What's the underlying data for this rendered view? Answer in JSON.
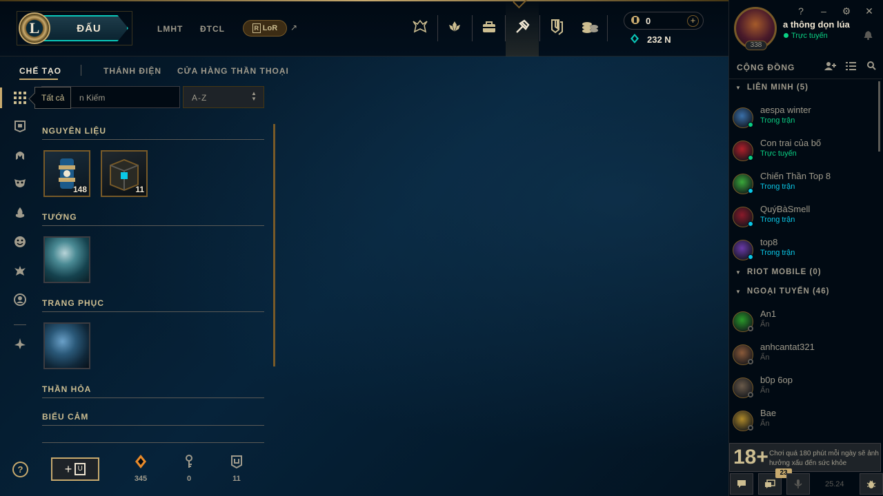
{
  "header": {
    "logo": "L",
    "play_label": "ĐẤU",
    "nav": [
      "LMHT",
      "ĐTCL"
    ],
    "lor_label": "LoR",
    "lor_box": "R",
    "ext_arrow": "↗",
    "rp_amount": "0",
    "be_amount": "232 N",
    "top_icons": [
      "home-icon",
      "collection-icon",
      "store-icon",
      "loot-icon",
      "clash-icon",
      "currency-icon"
    ]
  },
  "subnav": {
    "tabs": [
      "CHẾ TẠO",
      "THÁNH ĐIỆN",
      "CỬA HÀNG THẦN THOẠI"
    ],
    "tooltip": "Tất cả",
    "search_text": "n Kiếm",
    "sort_value": "A-Z"
  },
  "loot": {
    "sections": {
      "materials": "NGUYÊN LIỆU",
      "champions": "TƯỚNG",
      "skins": "TRANG PHỤC",
      "ward_skins": "THẦN HỎA",
      "emotes": "BIỂU CẢM"
    },
    "materials": [
      {
        "count": "148"
      },
      {
        "count": "11"
      }
    ]
  },
  "footer": {
    "help": "?",
    "plus": "+",
    "key_box": "U",
    "resources": [
      {
        "icon": "orange-essence-icon",
        "value": "345"
      },
      {
        "icon": "key-fragment-icon",
        "value": "0"
      },
      {
        "icon": "key-icon",
        "value": "11"
      }
    ]
  },
  "summoner": {
    "name": "a thông dọn lúa",
    "status": "Trực tuyến",
    "level": "338"
  },
  "social": {
    "header": "CỘNG ĐỒNG",
    "groups": {
      "alliance": "LIÊN MINH (5)",
      "riot_mobile": "RIOT MOBILE (0)",
      "offline": "NGOẠI TUYẾN (46)"
    },
    "friends_online": [
      {
        "name": "aespa winter",
        "status": "Trong trận",
        "status_color": "#0acf83",
        "avatar_color": "#3a6fa8"
      },
      {
        "name": "Con trai của bố",
        "status": "Trực tuyến",
        "status_color": "#0acf83",
        "avatar_color": "#b0202a"
      },
      {
        "name": "Chiến Thần Top 8",
        "status": "Trong trận",
        "status_color": "#0ac8e8",
        "avatar_color": "#3aa83a"
      },
      {
        "name": "QuýBàSmell",
        "status": "Trong trận",
        "status_color": "#0ac8e8",
        "avatar_color": "#8a1a2a"
      },
      {
        "name": "top8",
        "status": "Trong trận",
        "status_color": "#0ac8e8",
        "avatar_color": "#6a3aa8"
      }
    ],
    "friends_offline": [
      {
        "name": "An1",
        "status": "Ẩn",
        "avatar_color": "#2a9a2a"
      },
      {
        "name": "anhcantat321",
        "status": "Ẩn",
        "avatar_color": "#8a5a3a"
      },
      {
        "name": "b0p 6op",
        "status": "Ẩn",
        "avatar_color": "#6a5a4a"
      },
      {
        "name": "Bae",
        "status": "Ẩn",
        "avatar_color": "#b08a2a"
      }
    ],
    "warning_age": "18+",
    "warning_text": "Chơi quá 180 phút mỗi ngày sẽ ảnh hưởng xấu đến sức khỏe",
    "message_badge": "23",
    "version": "25.24"
  },
  "colors": {
    "gold": "#c8aa6e",
    "teal": "#0ac8b9",
    "online_green": "#0acf83",
    "ingame_blue": "#0ac8e8"
  }
}
